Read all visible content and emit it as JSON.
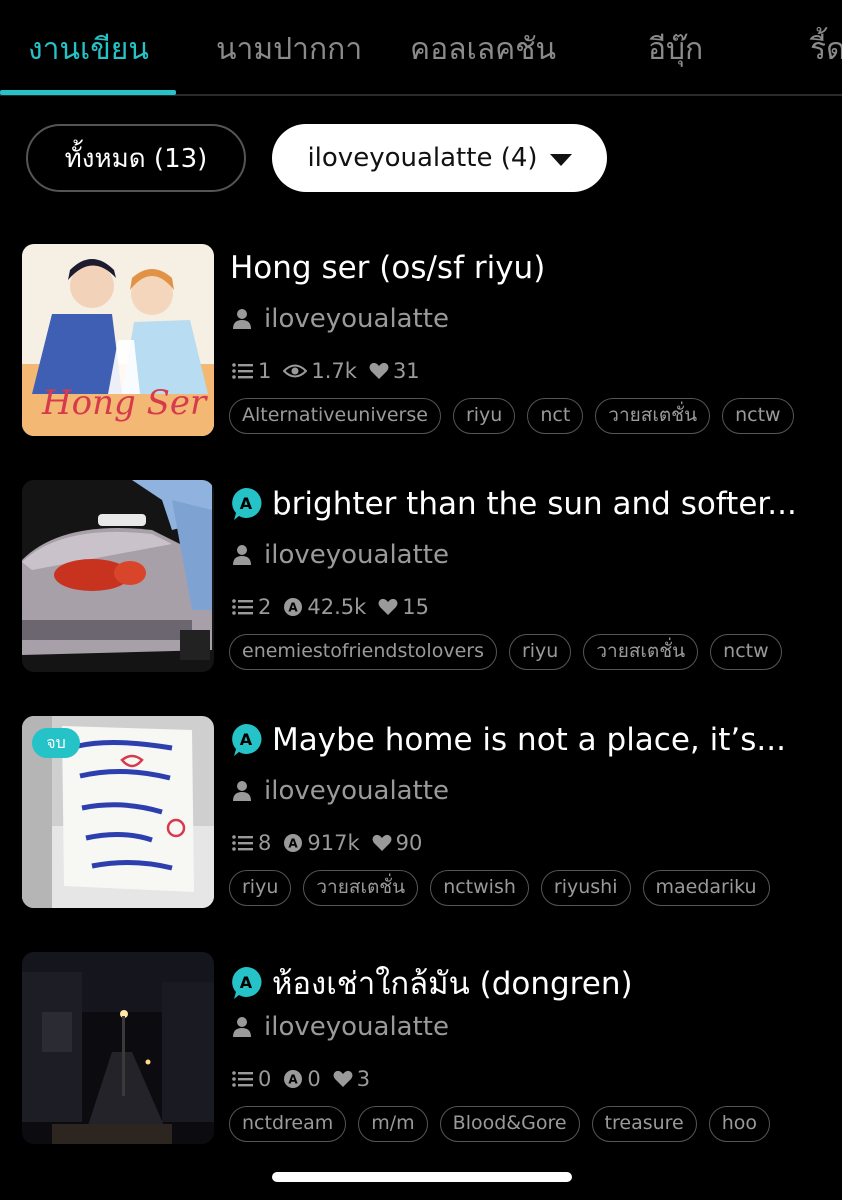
{
  "tabs": [
    {
      "label": "งานเขียน",
      "active": true
    },
    {
      "label": "นามปากกา",
      "active": false
    },
    {
      "label": "คอลเลคชัน",
      "active": false
    },
    {
      "label": "อีบุ๊ก",
      "active": false
    },
    {
      "label": "รี้ด",
      "active": false
    }
  ],
  "filters": {
    "all_label": "ทั้งหมด (13)",
    "author_label": "iloveyoualatte (4)"
  },
  "colors": {
    "accent": "#25c2c7",
    "background": "#000000",
    "muted_text": "#9a9a9a"
  },
  "stories": [
    {
      "title": "Hong ser (os/sf riyu)",
      "has_a_icon": false,
      "completed_badge": "",
      "author": "iloveyoualatte",
      "chapters": "1",
      "views": "1.7k",
      "views_icon": "eye-icon",
      "likes": "31",
      "tags": [
        "Alternativeuniverse",
        "riyu",
        "nct",
        "วายสเตชั่น",
        "nctw"
      ]
    },
    {
      "title": "brighter than the sun and softer...",
      "has_a_icon": true,
      "completed_badge": "",
      "author": "iloveyoualatte",
      "chapters": "2",
      "views": "42.5k",
      "views_icon": "a-coin-icon",
      "likes": "15",
      "tags": [
        "enemiestofriendstolovers",
        "riyu",
        "วายสเตชั่น",
        "nctw"
      ]
    },
    {
      "title": "Maybe home is not a place, it’s...",
      "has_a_icon": true,
      "completed_badge": "จบ",
      "author": "iloveyoualatte",
      "chapters": "8",
      "views": "917k",
      "views_icon": "a-coin-icon",
      "likes": "90",
      "tags": [
        "riyu",
        "วายสเตชั่น",
        "nctwish",
        "riyushi",
        "maedariku"
      ]
    },
    {
      "title": "ห้องเช่าใกล้มัน (dongren)",
      "has_a_icon": true,
      "completed_badge": "",
      "author": "iloveyoualatte",
      "chapters": "0",
      "views": "0",
      "views_icon": "a-coin-icon",
      "likes": "3",
      "tags": [
        "nctdream",
        "m/m",
        "Blood&Gore",
        "treasure",
        "hoo"
      ]
    }
  ]
}
